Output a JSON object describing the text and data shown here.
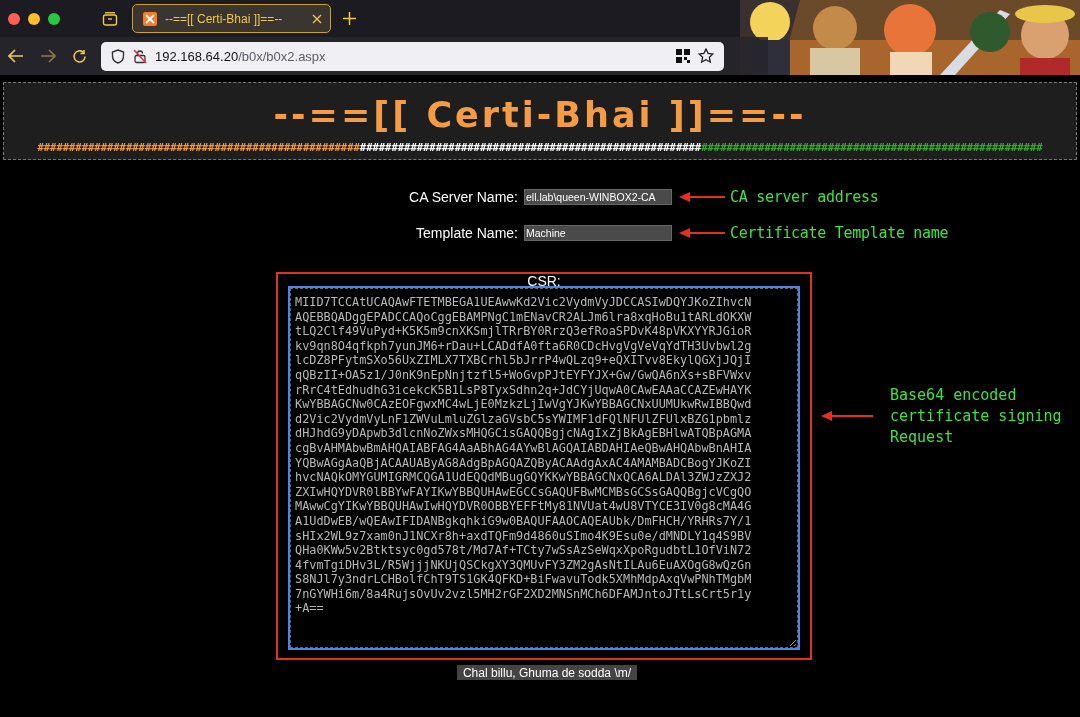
{
  "browser": {
    "tabs": [
      {
        "title": "--==[[ Certi-Bhai ]]==--",
        "selected": true
      }
    ],
    "url": {
      "host": "192.168.64.20",
      "path": "/b0x/b0x2.aspx"
    }
  },
  "header": {
    "title": "--==[[ Certi-Bhai ]]==--",
    "rule": [
      {
        "text": "###################################################",
        "color": "#f0993e"
      },
      {
        "text": "######################################################",
        "color": "#ffffff"
      },
      {
        "text": "######################################################",
        "color": "#3aa832"
      }
    ]
  },
  "fields": [
    {
      "label": "CA Server Name:",
      "value": "ell.lab\\queen-WINBOX2-CA",
      "note": "CA server address"
    },
    {
      "label": "Template Name:",
      "value": "Machine",
      "note": "Certificate Template name"
    }
  ],
  "csr": {
    "label": "CSR:",
    "value": "MIID7TCCAtUCAQAwFTETMBEGA1UEAwwKd2Vic2VydmVyJDCCASIwDQYJKoZIhvcN\nAQEBBQADggEPADCCAQoCggEBAMPNgC1mENavCR2ALJm6lra8xqHoBu1tARLdOKXW\ntLQ2Clf49VuPyd+K5K5m9cnXKSmjlTRrBY0RrzQ3efRoaSPDvK48pVKXYYRJGioR\nkv9qn8O4qfkph7yunJM6+rDau+LCADdfA0fta6R0CDcHvgVgVeVqYdTH3Uvbwl2g\nlcDZ8PFytmSXo56UxZIMLX7TXBCrhl5bJrrP4wQLzq9+eQXITvv8EkylQGXjJQjI\nqQBzII+OA5z1/J0nK9nEpNnjtzfl5+WoGvpPJtEYFYJX+Gw/GwQA6nXs+sBFVWxv\nrRrC4tEdhudhG3icekcK5B1LsP8TyxSdhn2q+JdCYjUqwA0CAwEAAaCCAZEwHAYK\nKwYBBAGCNw0CAzEOFgwxMC4wLjE0MzkzLjIwVgYJKwYBBAGCNxUUMUkwRwIBBQwd\nd2Vic2VydmVyLnF1ZWVuLmluZGlzaGVsbC5sYWIMF1dFQlNFUlZFUlxBZG1pbmlz\ndHJhdG9yDApwb3dlcnNoZWxsMHQGCisGAQQBgjcNAgIxZjBkAgEBHlwATQBpAGMA\ncgBvAHMAbwBmAHQAIABFAG4AaABhAG4AYwBlAGQAIABDAHIAeQBwAHQAbwBnAHIA\nYQBwAGgAaQBjACAAUAByAG8AdgBpAGQAZQByACAAdgAxAC4AMAMBADCBogYJKoZI\nhvcNAQkOMYGUMIGRMCQGA1UdEQQdMBugGQYKKwYBBAGCNxQCA6ALDAl3ZWJzZXJ2\nZXIwHQYDVR0lBBYwFAYIKwYBBQUHAwEGCCsGAQUFBwMCMBsGCSsGAQQBgjcVCgQO\nMAwwCgYIKwYBBQUHAwIwHQYDVR0OBBYEFFtMy81NVUat4wU8VTYCE3IV0g8cMA4G\nA1UdDwEB/wQEAwIFIDANBgkqhkiG9w0BAQUFAAOCAQEAUbk/DmFHCH/YRHRs7Y/1\nsHIx2WL9z7xam0nJ1NCXr8h+axdTQFm9d4860uSImo4K9Esu0e/dMNDLY1q4S9BV\nQHa0KWw5v2Btktsyc0gd578t/Md7Af+TCty7wSsAzSeWqxXpoRgudbtL1OfViN72\n4fvmTgiDHv3L/R5WjjjNKUjQSCkgXY3QMUvFY3ZM2gAsNtILAu6EuAXOgG8wQzGn\nS8NJl7y3ndrLCHBolfChT9TS1GK4QFKD+BiFwavuTodk5XMhMdpAxqVwPNhTMgbM\n7nGYWHi6m/8a4RujsOvUv2vzl5MH2rGF2XD2MNSnMCh6DFAMJntoJTtLsCrt5r1y\n+A==",
    "note": "Base64 encoded certificate signing Request"
  },
  "submit": "Chal billu, Ghuma de sodda \\m/"
}
